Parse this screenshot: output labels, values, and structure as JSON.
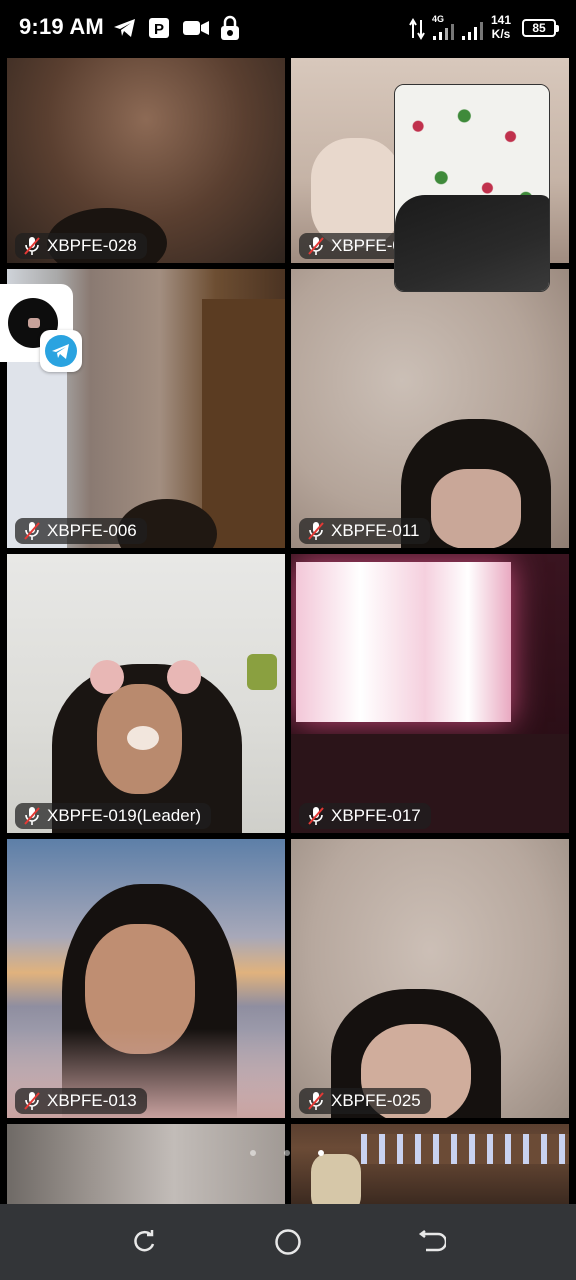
{
  "status_bar": {
    "time": "9:19 AM",
    "network_type": "4G",
    "net_speed_value": "141",
    "net_speed_unit": "K/s",
    "battery": "85",
    "icons": [
      "telegram-icon",
      "parking-icon",
      "video-camera-icon",
      "lock-icon",
      "data-arrows-icon",
      "signal-icon",
      "signal-icon",
      "battery-icon"
    ]
  },
  "participants": [
    {
      "name": "XBPFE-028",
      "muted": true
    },
    {
      "name": "XBPFE-0",
      "muted": true
    },
    {
      "name": "XBPFE-006",
      "muted": true
    },
    {
      "name": "XBPFE-011",
      "muted": true
    },
    {
      "name": "XBPFE-019(Leader)",
      "muted": true
    },
    {
      "name": "XBPFE-017",
      "muted": true
    },
    {
      "name": "XBPFE-013",
      "muted": true
    },
    {
      "name": "XBPFE-025",
      "muted": true
    },
    {
      "name": "",
      "muted": false
    },
    {
      "name": "",
      "muted": false
    }
  ],
  "floating_bubble": {
    "app": "telegram-icon"
  },
  "page_indicator": {
    "total": 3,
    "current": 3
  },
  "nav_bar": {
    "buttons": [
      "recents",
      "home",
      "back"
    ]
  }
}
